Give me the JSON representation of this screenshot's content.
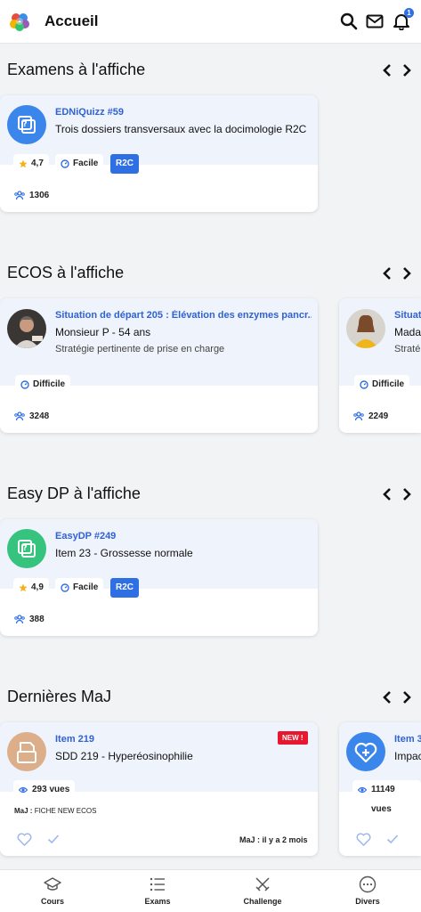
{
  "header": {
    "title": "Accueil",
    "notification_count": "1"
  },
  "sections": {
    "exams": {
      "title": "Examens à l'affiche",
      "card": {
        "kicker": "EDNiQuizz #59",
        "title": "Trois dossiers transversaux avec la docimologie R2C",
        "rating": "4,7",
        "difficulty": "Facile",
        "tag": "R2C",
        "participants": "1306"
      }
    },
    "ecos": {
      "title": "ECOS à l'affiche",
      "card1": {
        "kicker": "Situation de départ 205 : Élévation des enzymes pancr...",
        "title": "Monsieur P - 54 ans",
        "subtitle": "Stratégie pertinente de prise en charge",
        "difficulty": "Difficile",
        "participants": "3248"
      },
      "card2": {
        "kicker": "Situat",
        "title": "Mada",
        "subtitle": "Straté",
        "difficulty": "Difficile",
        "participants": "2249"
      }
    },
    "easydp": {
      "title": "Easy DP à l'affiche",
      "card": {
        "kicker": "EasyDP #249",
        "title": "Item 23 - Grossesse normale",
        "rating": "4,9",
        "difficulty": "Facile",
        "tag": "R2C",
        "participants": "388"
      }
    },
    "updates": {
      "title": "Dernières MaJ",
      "card1": {
        "kicker": "Item 219",
        "title": "SDD 219 - Hyperéosinophilie",
        "new_label": "NEW !",
        "views": "293 vues",
        "maj_label": "MaJ :",
        "maj_text": "FICHE NEW ECOS",
        "updated": "MaJ : il y a 2 mois"
      },
      "card2": {
        "kicker": "Item 3",
        "title": "Impac",
        "views": "11149 vues"
      }
    }
  },
  "bottom_nav": [
    {
      "label": "Cours",
      "icon": "graduation-cap-icon"
    },
    {
      "label": "Exams",
      "icon": "list-icon"
    },
    {
      "label": "Challenge",
      "icon": "crossed-swords-icon"
    },
    {
      "label": "Divers",
      "icon": "more-circle-icon"
    }
  ],
  "colors": {
    "accent": "#2f6fe4",
    "kicker": "#2f62d6",
    "new": "#e8162e",
    "card_top": "#eff3fb",
    "easydp": "#35c37d"
  }
}
